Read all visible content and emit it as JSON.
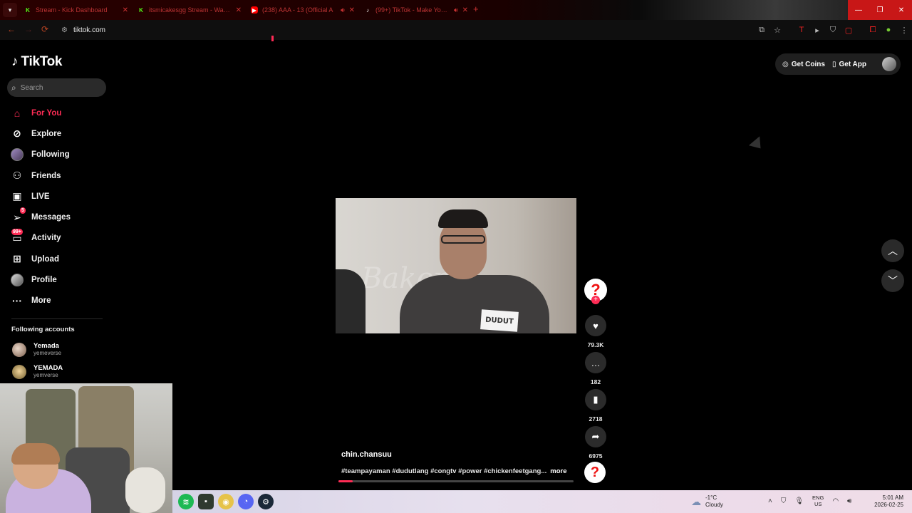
{
  "browser": {
    "tabs": [
      {
        "title": "Stream - Kick Dashboard",
        "favicon": "kick-icon",
        "color": "#53fc18"
      },
      {
        "title": "itsmicakesgg Stream - Watch L",
        "favicon": "kick-icon",
        "color": "#53fc18"
      },
      {
        "title": "(238) AAA - 13 (Official A",
        "favicon": "youtube-icon",
        "color": "#ff0000"
      },
      {
        "title": "(99+) TikTok - Make Your D",
        "favicon": "tiktok-icon",
        "color": "#ffffff"
      }
    ],
    "url": "tiktok.com"
  },
  "tiktok": {
    "logo_text": "TikTok",
    "search_placeholder": "Search",
    "nav": [
      {
        "label": "For You",
        "icon": "home-icon",
        "active": true
      },
      {
        "label": "Explore",
        "icon": "compass-icon"
      },
      {
        "label": "Following",
        "icon": "avatar-icon"
      },
      {
        "label": "Friends",
        "icon": "friends-icon"
      },
      {
        "label": "LIVE",
        "icon": "live-tv-icon"
      },
      {
        "label": "Messages",
        "icon": "send-icon",
        "badge": "5"
      },
      {
        "label": "Activity",
        "icon": "inbox-icon",
        "badge": "99+"
      },
      {
        "label": "Upload",
        "icon": "plus-square-icon"
      },
      {
        "label": "Profile",
        "icon": "profile-avatar-icon"
      },
      {
        "label": "More",
        "icon": "ellipsis-icon"
      }
    ],
    "following_title": "Following accounts",
    "following_accounts": [
      {
        "name": "Yemada",
        "handle": "yemeverse"
      },
      {
        "name": "YEMADA",
        "handle": "yemverse"
      }
    ],
    "top_buttons": {
      "coins": "Get Coins",
      "app": "Get App"
    },
    "video": {
      "name_tag": "DUDUT",
      "watermark": "Baker",
      "author": "chin.chansuu",
      "caption": "#teampayaman #dudutlang #congtv #power #chickenfeetgang...",
      "more": "more",
      "likes": "79.3K",
      "comments": "182",
      "saves": "2718",
      "shares": "6975",
      "progress": 0.06
    },
    "accent": "#fe2c55"
  },
  "taskbar": {
    "weather_temp": "-1°C",
    "weather_desc": "Cloudy",
    "lang_top": "ENG",
    "lang_bottom": "US",
    "time": "5:01 AM",
    "date": "2026-02-25"
  }
}
